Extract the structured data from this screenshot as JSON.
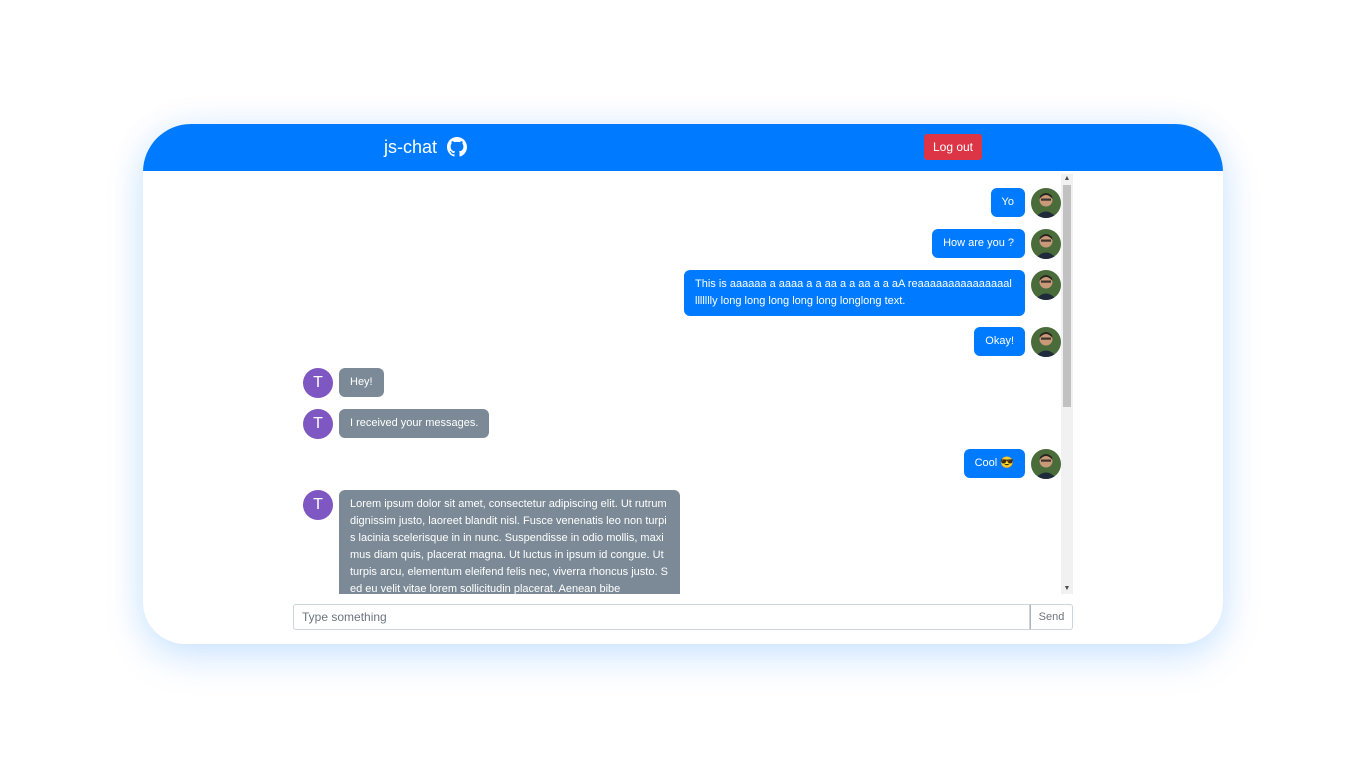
{
  "header": {
    "app_title": "js-chat",
    "github_icon": "github-icon",
    "logout_label": "Log out"
  },
  "messages": [
    {
      "side": "out",
      "text": "Yo"
    },
    {
      "side": "out",
      "text": "How are you ?"
    },
    {
      "side": "out",
      "text": "This is aaaaaa a aaaa a a aa a a aa a a aA reaaaaaaaaaaaaaaalllllllly long long long long long longlong text."
    },
    {
      "side": "out",
      "text": "Okay!"
    },
    {
      "side": "in",
      "avatar": "T",
      "text": "Hey!"
    },
    {
      "side": "in",
      "avatar": "T",
      "text": "I received your messages."
    },
    {
      "side": "out",
      "text": "Cool 😎"
    },
    {
      "side": "in",
      "avatar": "T",
      "text": "Lorem ipsum dolor sit amet, consectetur adipiscing elit. Ut rutrum dignissim justo, laoreet blandit nisl. Fusce venenatis leo non turpis lacinia scelerisque in in nunc. Suspendisse in odio mollis, maximus diam quis, placerat magna. Ut luctus in ipsum id congue. Ut turpis arcu, elementum eleifend felis nec, viverra rhoncus justo. Sed eu velit vitae lorem sollicitudin placerat. Aenean bibe"
    }
  ],
  "composer": {
    "placeholder": "Type something",
    "send_label": "Send"
  },
  "colors": {
    "primary": "#007bff",
    "danger": "#dc3545",
    "incoming_bubble": "#7b8a96",
    "avatar_bg": "#7e57c2"
  }
}
